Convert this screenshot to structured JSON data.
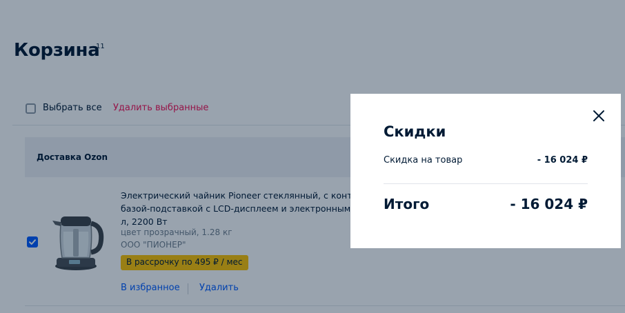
{
  "page": {
    "title": "Корзина",
    "title_count": "11"
  },
  "toolbar": {
    "select_all": "Выбрать все",
    "delete_selected": "Удалить выбранные"
  },
  "delivery": {
    "label": "Доставка Ozon"
  },
  "product": {
    "checked": true,
    "name_lines": [
      "Электрический чайник Pioneer стеклянный, с контро",
      "базой-подставкой с LCD-дисплеем и электронным у",
      "л, 2200 Вт"
    ],
    "attribute": "цвет прозрачный, 1.28 кг",
    "seller": "ООО \"ПИОНЕР\"",
    "installment": "В рассрочку по 495 ₽ / мес",
    "favorite_link": "В избранное",
    "delete_link": "Удалить"
  },
  "modal": {
    "title": "Скидки",
    "discount_label": "Скидка на товар",
    "discount_value": "- 16 024 ₽",
    "total_label": "Итого",
    "total_value": "- 16 024 ₽",
    "close_icon": "close-icon"
  },
  "colors": {
    "accent_blue": "#005bff",
    "danger_pink": "#f91155",
    "installment_yellow": "#ffc400",
    "text_dark": "#001a34"
  }
}
